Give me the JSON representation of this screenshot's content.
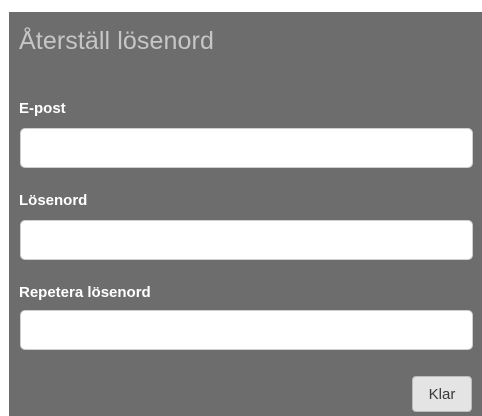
{
  "form": {
    "title": "Återställ lösenord",
    "fields": [
      {
        "label": "E-post",
        "value": "",
        "placeholder": ""
      },
      {
        "label": "Lösenord",
        "value": "",
        "placeholder": ""
      },
      {
        "label": "Repetera lösenord",
        "value": "",
        "placeholder": ""
      }
    ],
    "submit_label": "Klar"
  },
  "colors": {
    "panel_background": "#6d6d6d",
    "title_text": "#c6c6c6",
    "label_text": "#ffffff",
    "input_background": "#ffffff",
    "button_background": "#e4e4e4"
  }
}
